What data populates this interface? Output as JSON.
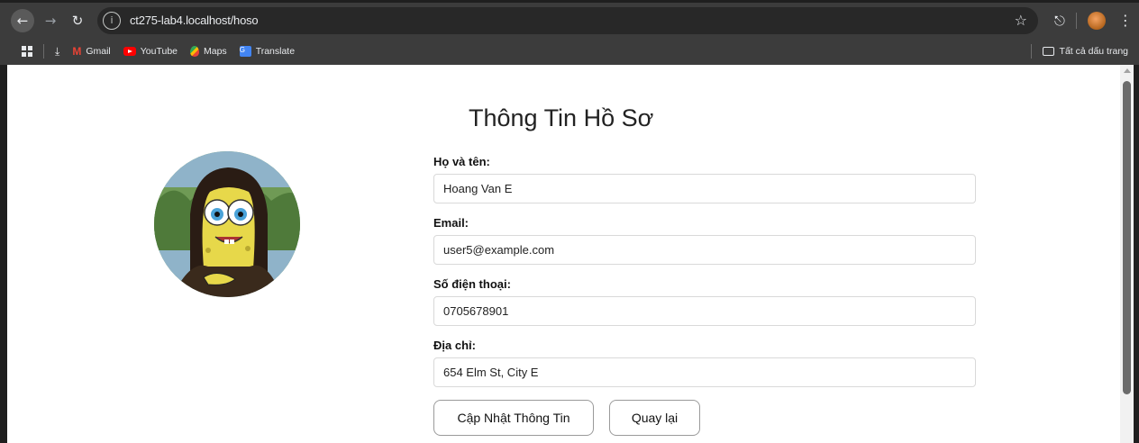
{
  "browser": {
    "url": "ct275-lab4.localhost/hoso",
    "bookmarks": [
      {
        "label": "Gmail",
        "icon": "gmail-icon"
      },
      {
        "label": "YouTube",
        "icon": "youtube-icon"
      },
      {
        "label": "Maps",
        "icon": "maps-icon"
      },
      {
        "label": "Translate",
        "icon": "translate-icon"
      }
    ],
    "all_bookmarks_label": "Tất cả dấu trang"
  },
  "page": {
    "title": "Thông Tin Hồ Sơ",
    "fields": {
      "name_label": "Họ và tên:",
      "name_value": "Hoang Van E",
      "email_label": "Email:",
      "email_value": "user5@example.com",
      "phone_label": "Số điện thoại:",
      "phone_value": "0705678901",
      "address_label": "Địa chỉ:",
      "address_value": "654 Elm St, City E"
    },
    "update_button": "Cập Nhật Thông Tin",
    "back_button": "Quay lại"
  },
  "colors": {
    "toolbar_bg": "#3c3c3c",
    "omnibox_bg": "#282828",
    "page_bg": "#ffffff",
    "input_border": "#d9d9d9"
  }
}
